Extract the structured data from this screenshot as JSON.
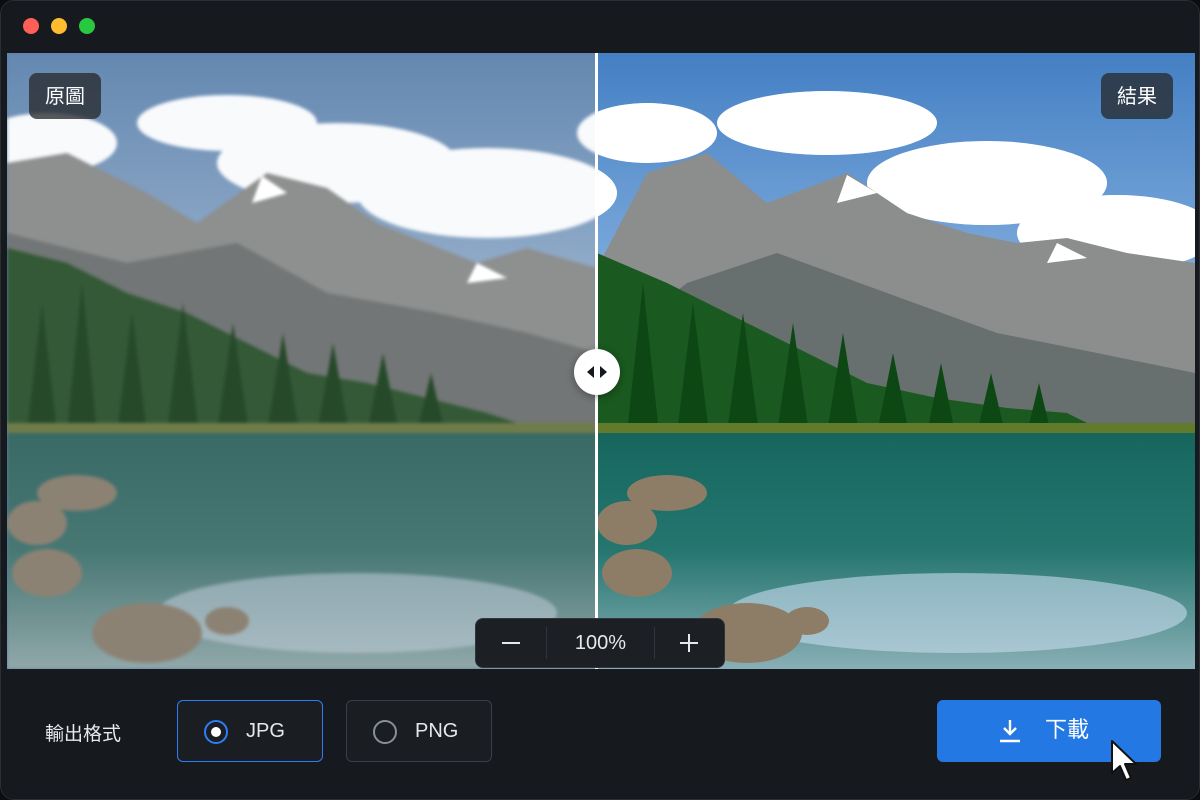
{
  "labels": {
    "original": "原圖",
    "result": "結果"
  },
  "zoom": {
    "value": "100%",
    "decrease_icon": "minus-icon",
    "increase_icon": "plus-icon"
  },
  "export": {
    "format_label": "輸出格式",
    "options": [
      {
        "label": "JPG",
        "selected": true
      },
      {
        "label": "PNG",
        "selected": false
      }
    ],
    "download_label": "下載",
    "download_icon": "download-icon"
  },
  "colors": {
    "accent": "#2f7df6",
    "button": "#2478e3",
    "window_bg": "#16191e"
  }
}
